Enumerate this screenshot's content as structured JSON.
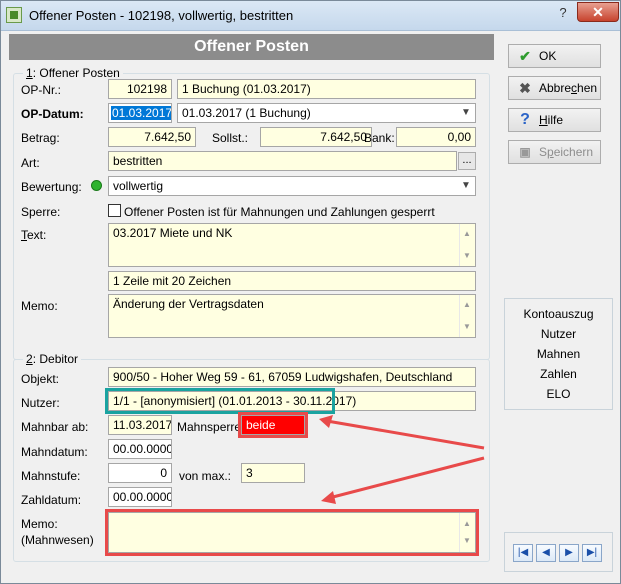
{
  "window": {
    "title": "Offener Posten - 102198, vollwertig, bestritten",
    "help": "?",
    "close": "✕"
  },
  "header": {
    "title": "Offener Posten"
  },
  "section1": {
    "legend_prefix": "1",
    "legend_rest": ": Offener Posten",
    "op_nr_label": "OP-Nr.:",
    "op_nr_value": "102198",
    "op_nr_desc": "1 Buchung (01.03.2017)",
    "op_datum_label": "OP-Datum:",
    "op_datum_value": "01.03.2017",
    "op_datum_select": "01.03.2017 (1 Buchung)",
    "betrag_label": "Betrag:",
    "betrag_value": "7.642,50",
    "sollst_label": "Sollst.:",
    "sollst_value": "7.642,50",
    "bank_label": "Bank:",
    "bank_value": "0,00",
    "art_label": "Art:",
    "art_value": "bestritten",
    "art_button": "...",
    "bewertung_label": "Bewertung:",
    "bewertung_value": "vollwertig",
    "sperre_label": "Sperre:",
    "sperre_checkbox_label": "Offener Posten ist für Mahnungen und Zahlungen gesperrt",
    "text_label_prefix": "T",
    "text_label_rest": "ext:",
    "text_value": "03.2017 Miete und NK",
    "text_info": "1 Zeile mit 20 Zeichen",
    "memo_label": "Memo:",
    "memo_value": "Änderung der Vertragsdaten"
  },
  "section2": {
    "legend_prefix": "2",
    "legend_rest": ": Debitor",
    "objekt_label": "Objekt:",
    "objekt_value": "900/50 - Hoher Weg 59 - 61, 67059 Ludwigshafen, Deutschland",
    "nutzer_label": "Nutzer:",
    "nutzer_value": "1/1 - [anonymisiert] (01.01.2013 - 30.11.2017)",
    "mahnbar_label": "Mahnbar ab:",
    "mahnbar_value": "11.03.2017",
    "mahnsperre_label": "Mahnsperre:",
    "mahnsperre_value": "beide",
    "mahndatum_label": "Mahndatum:",
    "mahndatum_value": "00.00.0000",
    "mahnstufe_label": "Mahnstufe:",
    "mahnstufe_value": "0",
    "vonmax_label": "von max.:",
    "vonmax_value": "3",
    "zahldatum_label": "Zahldatum:",
    "zahldatum_value": "00.00.0000",
    "memo_label_1": "Memo:",
    "memo_label_2": "(Mahnwesen)",
    "memo_value": ""
  },
  "buttons": {
    "ok": "OK",
    "abbrechen_pre": "Abbre",
    "abbrechen_u": "c",
    "abbrechen_post": "hen",
    "hilfe_u": "H",
    "hilfe_post": "ilfe",
    "speichern_pre": "S",
    "speichern_u": "p",
    "speichern_post": "eichern"
  },
  "side_links": [
    "Kontoauszug",
    "Nutzer",
    "Mahnen",
    "Zahlen",
    "ELO"
  ],
  "nav": {
    "first": "|◀",
    "prev": "◀",
    "next": "▶",
    "last": "▶|"
  },
  "colors": {
    "annotation_red": "#e84a4a",
    "annotation_teal": "#1aa3a0",
    "field_yellow": "#ffffe1"
  }
}
